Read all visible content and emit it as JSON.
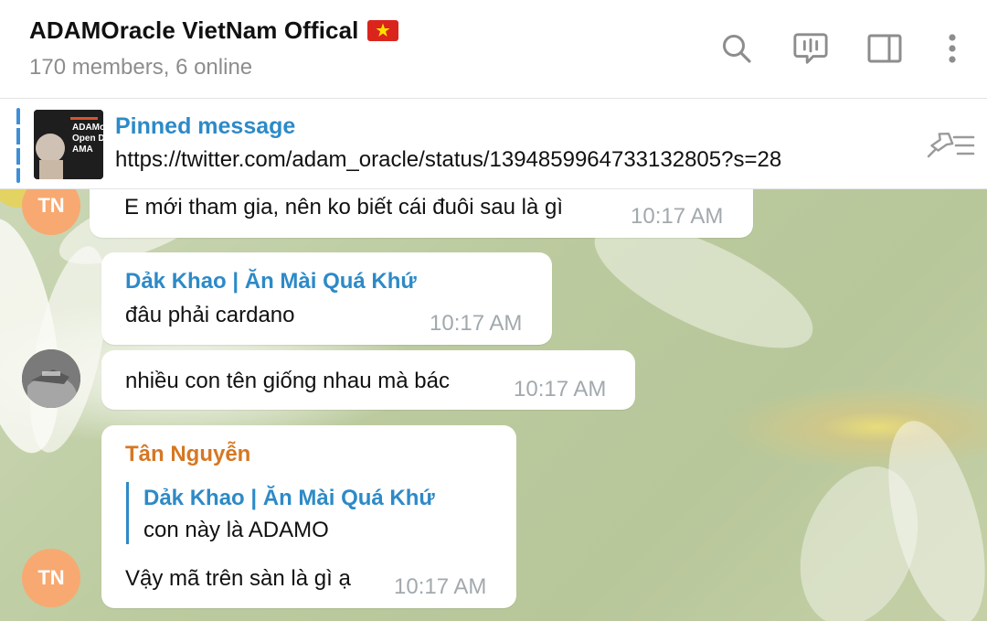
{
  "header": {
    "title": "ADAMOracle VietNam Offical",
    "subtitle": "170 members, 6 online",
    "flag_icon": "vietnam-flag-icon"
  },
  "pinned": {
    "title": "Pinned message",
    "text": "https://twitter.com/adam_oracle/status/1394859964733132805?s=28",
    "thumb_text": [
      "ADAMo",
      "Open D",
      "AMA"
    ]
  },
  "messages": [
    {
      "text": "E mới tham gia, nên ko biết cái đuôi sau là gì",
      "time": "10:17 AM"
    },
    {
      "sender": "Dảk Khao | Ăn Mài Quá Khứ",
      "text": "đâu phải cardano",
      "time": "10:17 AM"
    },
    {
      "text": "nhiều con tên giống nhau mà bác",
      "time": "10:17 AM"
    },
    {
      "sender": "Tân Nguyễn",
      "reply_sender": "Dảk Khao | Ăn Mài Quá Khứ",
      "reply_text": "con này là ADAMO",
      "text": "Vậy mã trên sàn là gì ạ",
      "time": "10:17 AM"
    }
  ],
  "avatars": {
    "tn_initials": "TN",
    "tn_color": "#f7a971"
  },
  "colors": {
    "link_blue": "#2d8ac7",
    "sender_orange": "#d67722",
    "time_gray": "#a2a9ad"
  }
}
